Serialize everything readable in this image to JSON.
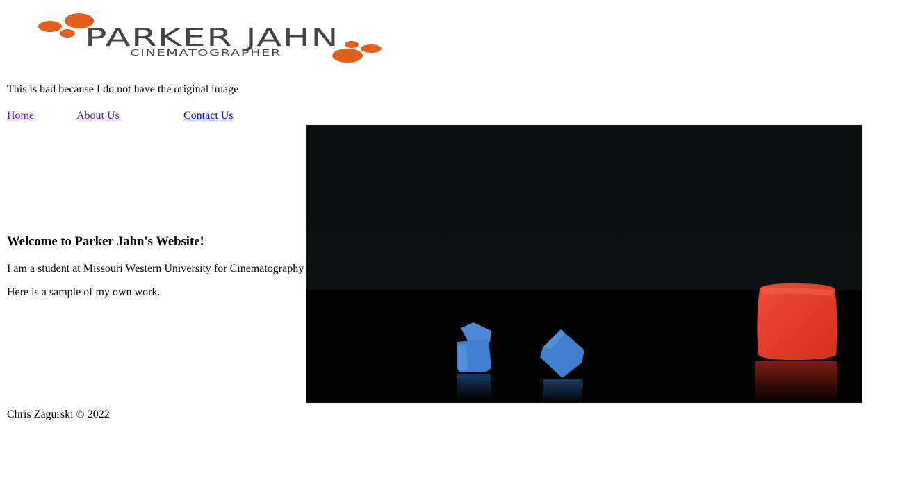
{
  "logo": {
    "name": "PARKER JAHN",
    "tagline": "CINEMATOGRAPHER",
    "accent_color": "#e2601c",
    "text_color": "#444444"
  },
  "note": "This is bad because I do not have the original image",
  "nav": {
    "items": [
      {
        "label": "Home",
        "state": "visited"
      },
      {
        "label": "About Us",
        "state": "visited"
      },
      {
        "label": "Contact Us",
        "state": "unvisited"
      }
    ],
    "link_color": "#0000ee",
    "visited_color": "#551a8b"
  },
  "main": {
    "heading": "Welcome to Parker Jahn's Website!",
    "intro": "I am a student at Missouri Western University for Cinematography",
    "sample": "Here is a sample of my own work."
  },
  "media": {
    "subject": "clay cubes on a dark tabletop",
    "colors": {
      "background": "#060909",
      "blue_clay": "#3f7fd0",
      "red_clay": "#ea3b2a"
    }
  },
  "footer": "Chris Zagurski © 2022"
}
